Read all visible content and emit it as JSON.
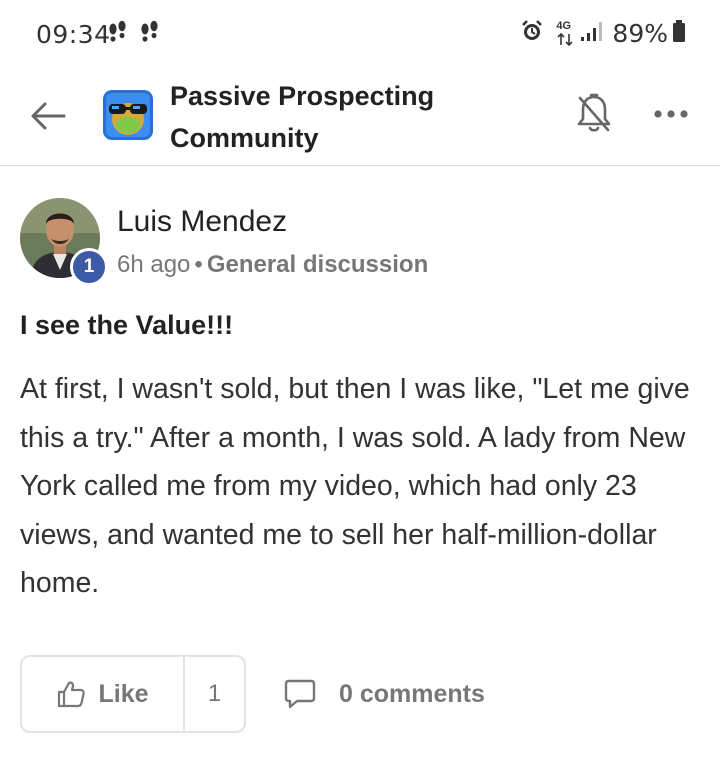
{
  "status_bar": {
    "time": "09:34",
    "notification_icons": [
      "footprints-icon",
      "footprints-icon"
    ],
    "network": "4G",
    "battery": "89%"
  },
  "header": {
    "group_name": "Passive Prospecting Community"
  },
  "post": {
    "author": "Luis Mendez",
    "level": "1",
    "time_ago": "6h ago",
    "separator": "•",
    "category": "General discussion",
    "title": "I see the Value!!!",
    "body": "At first, I wasn't sold, but then I was like, \"Let me give this a try.\" After a month, I was sold. A lady from New York called me from my video, which had only 23 views, and wanted me to sell her half-million-dollar home."
  },
  "actions": {
    "like_label": "Like",
    "like_count": "1",
    "comments_label": "0 comments"
  },
  "colors": {
    "accent": "#3d5aa6",
    "muted_text": "#777777",
    "border": "#e3e3e3"
  }
}
